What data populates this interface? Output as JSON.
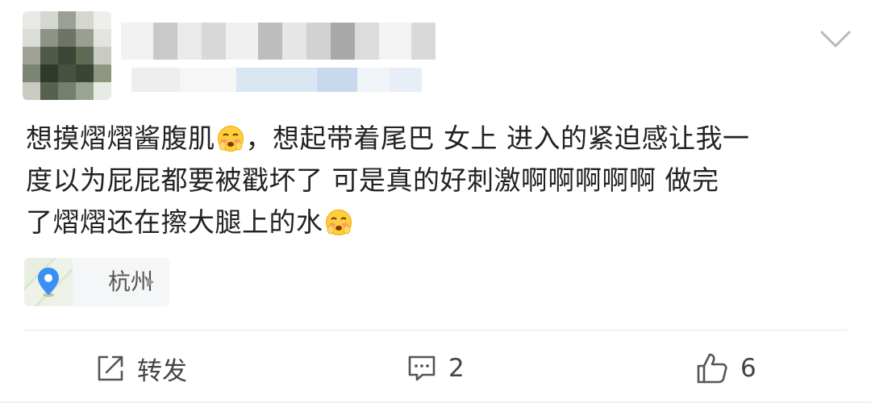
{
  "post": {
    "text_line1": "想摸熠熠酱腹肌",
    "text_line1b": "，想起带着尾巴 女上 进入的紧迫感让我一",
    "text_line2": "度以为屁屁都要被戳坏了 可是真的好刺激啊啊啊啊啊  做完",
    "text_line3": "了熠熠还在擦大腿上的水",
    "emoji_name": "shy-face-emoji"
  },
  "location": {
    "label": "杭州",
    "icon": "location-pin-icon"
  },
  "actions": {
    "repost_label": "转发",
    "comment_count": "2",
    "like_count": "6"
  },
  "colors": {
    "accent_blue": "#3a8ef6",
    "text": "#222222",
    "muted": "#555555"
  }
}
